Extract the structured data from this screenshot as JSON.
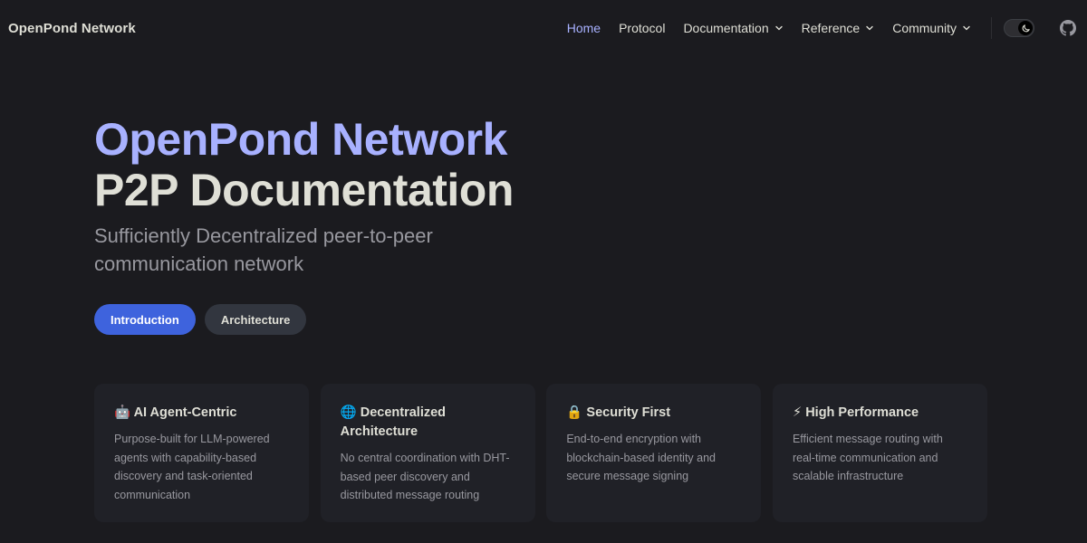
{
  "nav": {
    "brand": "OpenPond Network",
    "items": [
      {
        "label": "Home",
        "active": true,
        "dropdown": false
      },
      {
        "label": "Protocol",
        "active": false,
        "dropdown": false
      },
      {
        "label": "Documentation",
        "active": false,
        "dropdown": true
      },
      {
        "label": "Reference",
        "active": false,
        "dropdown": true
      },
      {
        "label": "Community",
        "active": false,
        "dropdown": true
      }
    ],
    "theme_toggle_icon": "moon-icon",
    "social_icon": "github-icon"
  },
  "hero": {
    "name": "OpenPond Network",
    "text": "P2P Documentation",
    "tagline": "Sufficiently Decentralized peer-to-peer communication network",
    "actions": [
      {
        "label": "Introduction",
        "theme": "brand"
      },
      {
        "label": "Architecture",
        "theme": "alt"
      }
    ]
  },
  "features": [
    {
      "icon": "🤖",
      "title": "AI Agent-Centric",
      "details": "Purpose-built for LLM-powered agents with capability-based discovery and task-oriented communication"
    },
    {
      "icon": "🌐",
      "title": "Decentralized Architecture",
      "details": "No central coordination with DHT-based peer discovery and distributed message routing"
    },
    {
      "icon": "🔒",
      "title": "Security First",
      "details": "End-to-end encryption with blockchain-based identity and secure message signing"
    },
    {
      "icon": "⚡",
      "title": "High Performance",
      "details": "Efficient message routing with real-time communication and scalable infrastructure"
    }
  ],
  "colors": {
    "background": "#1b1b1f",
    "accent_text": "#a8b1ff",
    "brand_button": "#3e63dd",
    "card_bg": "#202127"
  }
}
